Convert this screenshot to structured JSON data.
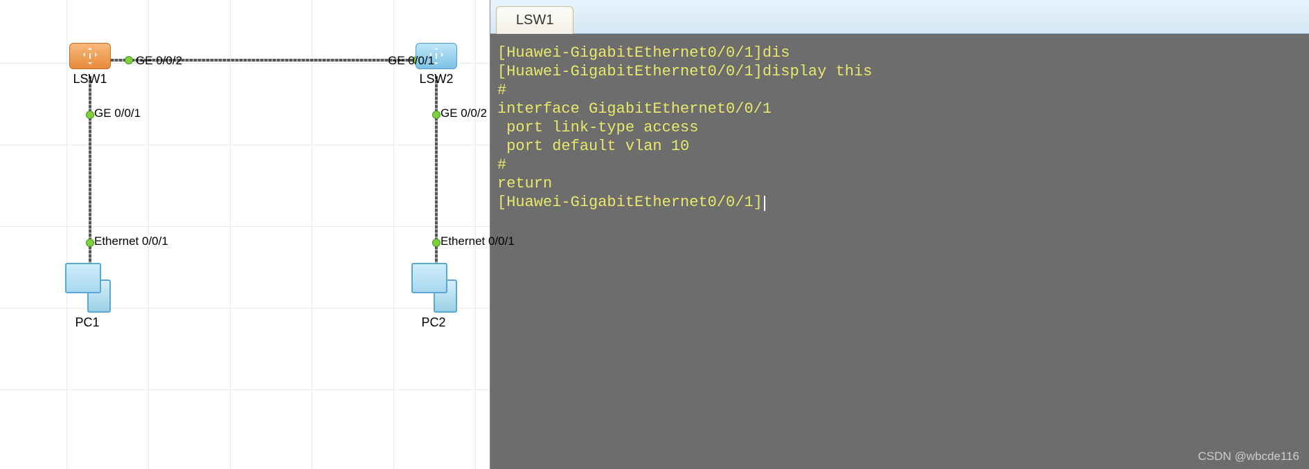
{
  "topology": {
    "devices": {
      "lsw1": {
        "label": "LSW1"
      },
      "lsw2": {
        "label": "LSW2"
      },
      "pc1": {
        "label": "PC1"
      },
      "pc2": {
        "label": "PC2"
      }
    },
    "ports": {
      "lsw1_ge002": "GE 0/0/2",
      "lsw1_ge001": "GE 0/0/1",
      "lsw2_ge001": "GE 0/0/1",
      "lsw2_ge002": "GE 0/0/2",
      "pc1_eth001": "Ethernet 0/0/1",
      "pc2_eth001": "Ethernet 0/0/1"
    }
  },
  "terminal": {
    "tab_label": "LSW1",
    "lines": [
      "[Huawei-GigabitEthernet0/0/1]dis",
      "[Huawei-GigabitEthernet0/0/1]display this",
      "#",
      "interface GigabitEthernet0/0/1",
      " port link-type access",
      " port default vlan 10",
      "#",
      "return",
      "[Huawei-GigabitEthernet0/0/1]"
    ]
  },
  "watermark": "CSDN @wbcde116"
}
